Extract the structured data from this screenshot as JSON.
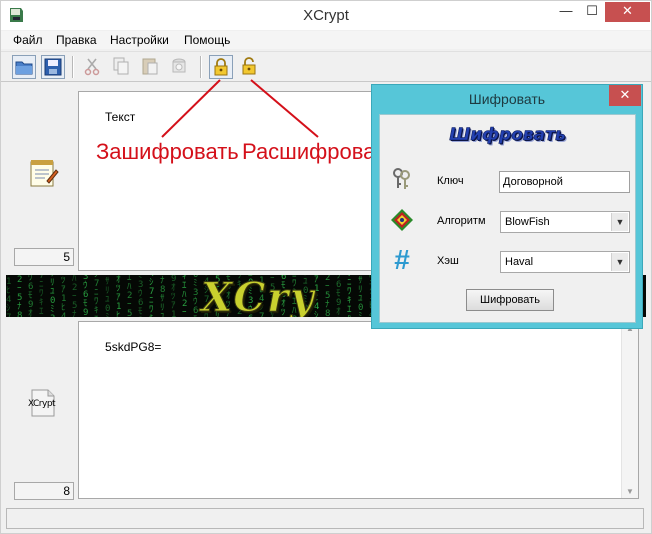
{
  "window": {
    "title": "XCrypt",
    "minimize_glyph": "—",
    "maximize_glyph": "☐",
    "close_glyph": "✕"
  },
  "menu": {
    "items": [
      {
        "label": "Файл"
      },
      {
        "label": "Правка"
      },
      {
        "label": "Настройки"
      },
      {
        "label": "Помощь"
      }
    ]
  },
  "toolbar": {
    "buttons": [
      {
        "icon": "folder-open-icon",
        "enabled": true
      },
      {
        "icon": "save-disk-icon",
        "enabled": true
      },
      {
        "icon": "scissors-icon",
        "enabled": false
      },
      {
        "icon": "copy-icon",
        "enabled": false
      },
      {
        "icon": "paste-icon",
        "enabled": false
      },
      {
        "icon": "clear-icon",
        "enabled": false
      },
      {
        "icon": "lock-closed-icon",
        "enabled": true
      },
      {
        "icon": "lock-open-icon",
        "enabled": true
      }
    ]
  },
  "input_panel": {
    "text": "Текст",
    "counter": "5",
    "icon": "notepad-icon"
  },
  "output_panel": {
    "text": "5skdPG8=",
    "counter": "8",
    "icon": "xcrypt-document-icon",
    "icon_label": "XCrypt"
  },
  "banner": {
    "logo_text": "XCry",
    "matrix_glyphs": "ｱ0ﾊ1ﾐ2ﾋ3ｰ4ｳ5ｼ6ﾅ7ﾓ8ﾆ9ｻﾜｵﾘｷﾂﾕｴ"
  },
  "annotations": {
    "encrypt": "Зашифровать",
    "decrypt": "Расшифровать",
    "color": "#d4101a"
  },
  "dialog": {
    "title": "Шифровать",
    "close_glyph": "✕",
    "heading": "Шифровать",
    "key_label": "Ключ",
    "key_value": "Договорной",
    "algorithm_label": "Алгоритм",
    "algorithm_value": "BlowFish",
    "hash_label": "Хэш",
    "hash_value": "Haval",
    "submit_label": "Шифровать",
    "title_bar_color": "#56c6d8"
  }
}
